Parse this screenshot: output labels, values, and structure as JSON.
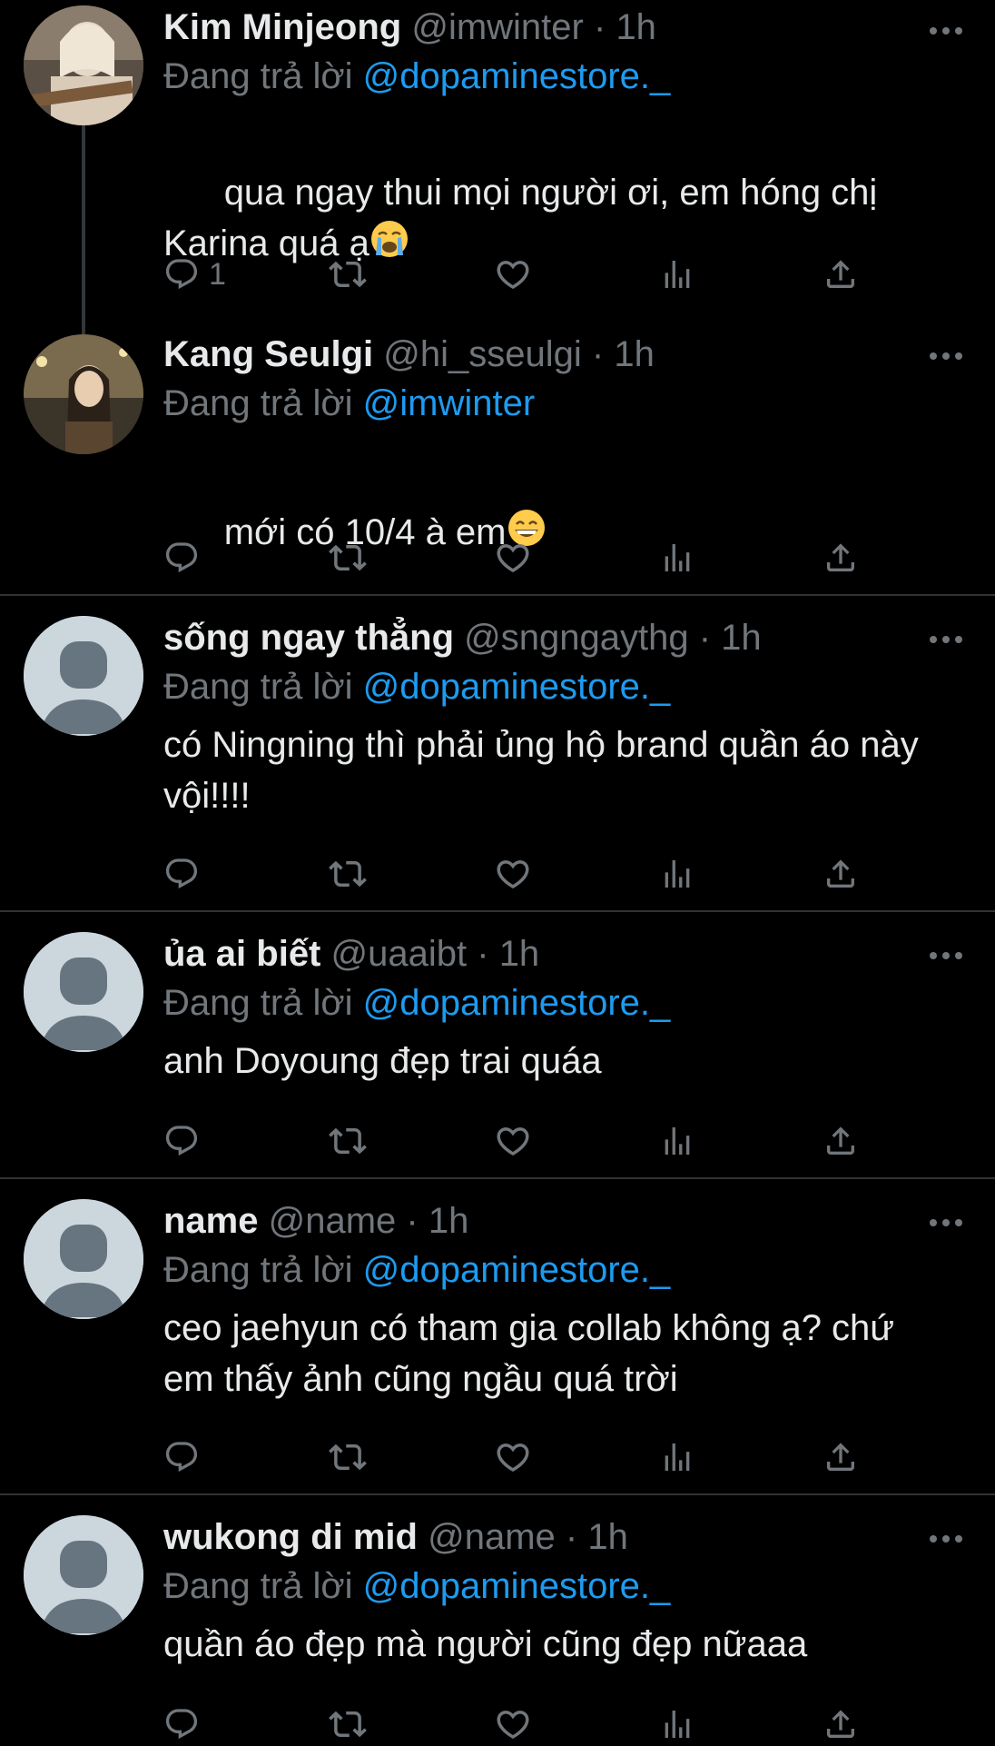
{
  "reply_prefix": "Đang trả lời",
  "colors": {
    "background": "#000000",
    "text": "#e7e9ea",
    "muted": "#71767b",
    "mention": "#1d9bf0",
    "divider": "#2f3336"
  },
  "tweets": [
    {
      "name": "Kim Minjeong",
      "handle": "@imwinter",
      "time": "1h",
      "reply_to": "@dopaminestore._",
      "text": "qua ngay thui mọi người ơi, em hóng chị Karina quá ạ",
      "emoji": "loudly-crying-face",
      "reply_count": "1"
    },
    {
      "name": "Kang Seulgi",
      "handle": "@hi_sseulgi",
      "time": "1h",
      "reply_to": "@imwinter",
      "text": "mới có 10/4 à em",
      "emoji": "grinning-face"
    },
    {
      "name": "sống ngay thẳng",
      "handle": "@sngngaythg",
      "time": "1h",
      "reply_to": "@dopaminestore._",
      "text": "có Ningning thì phải ủng hộ brand quần áo này vội!!!!"
    },
    {
      "name": "ủa ai biết",
      "handle": "@uaaibt",
      "time": "1h",
      "reply_to": "@dopaminestore._",
      "text": "anh Doyoung đẹp trai quáa"
    },
    {
      "name": "name",
      "handle": "@name",
      "time": "1h",
      "reply_to": "@dopaminestore._",
      "text": "ceo jaehyun có tham gia collab không ạ? chứ em thấy ảnh cũng ngầu quá trời"
    },
    {
      "name": "wukong di mid",
      "handle": "@name",
      "time": "1h",
      "reply_to": "@dopaminestore._",
      "text": "quần áo đẹp mà người cũng đẹp nữaaa"
    }
  ]
}
